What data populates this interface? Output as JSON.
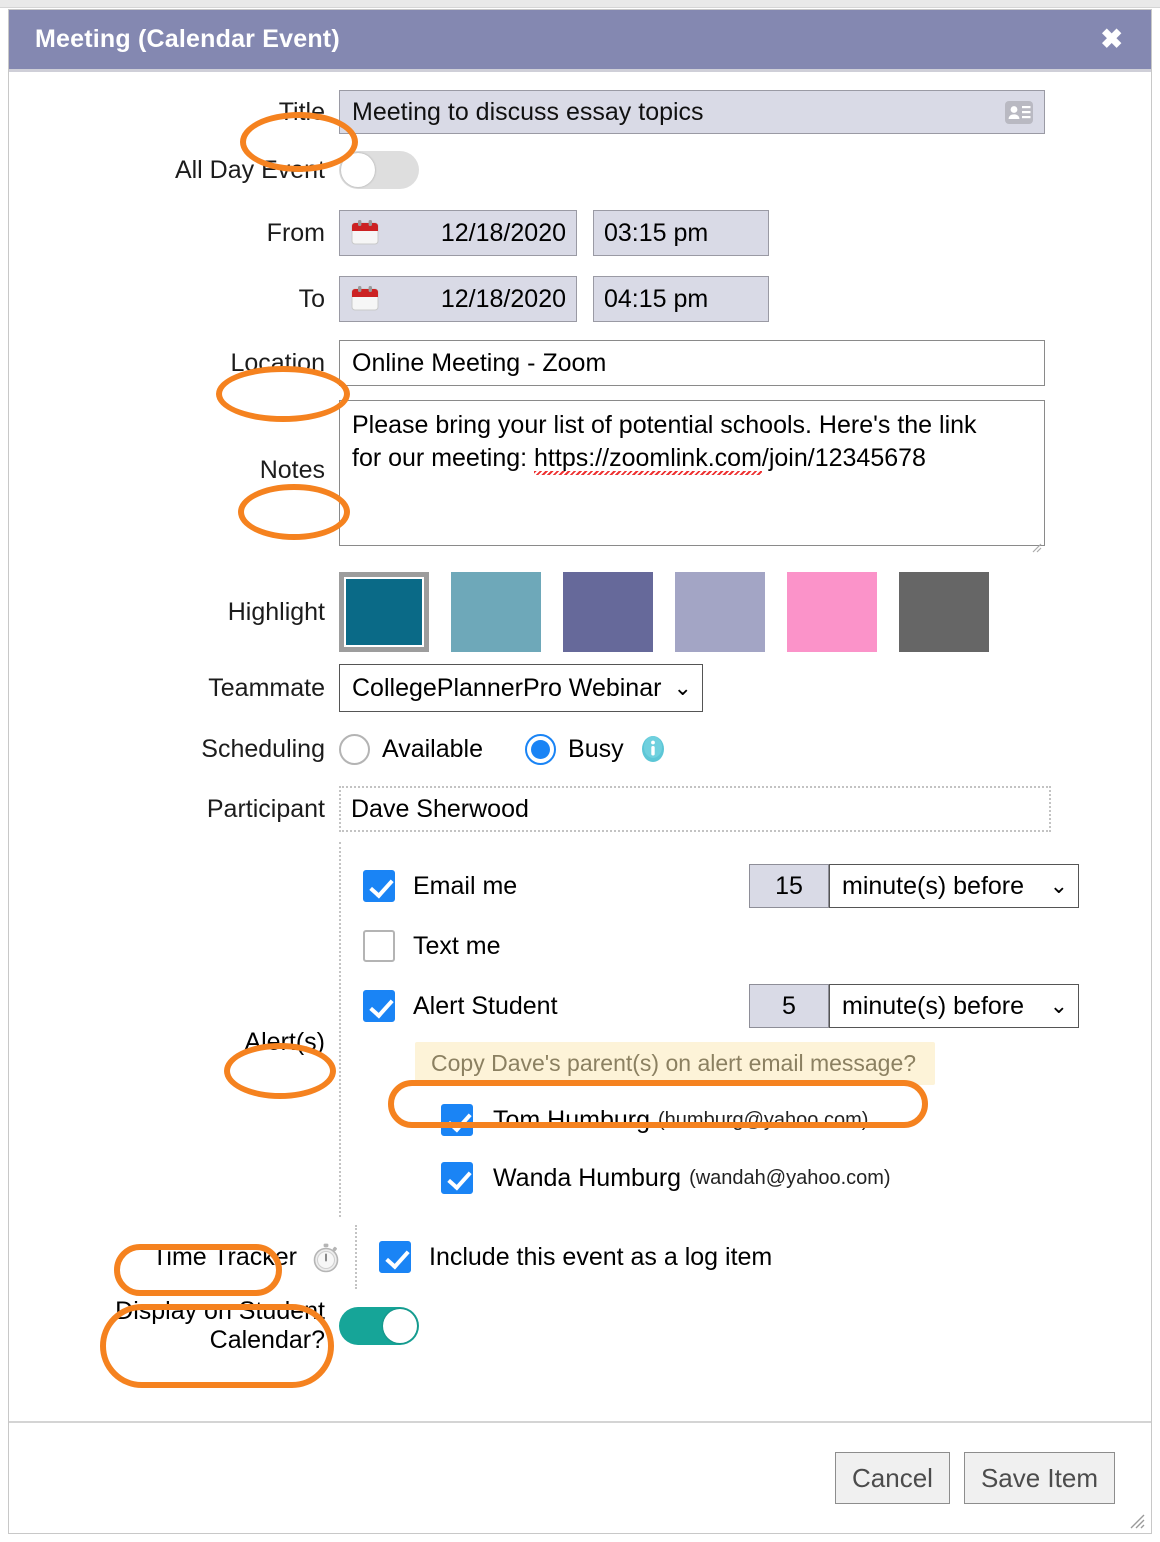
{
  "window": {
    "title": "Meeting (Calendar Event)",
    "close_label": "✖",
    "header_color": "#8488b1"
  },
  "form": {
    "title": {
      "label": "Title",
      "value": "Meeting to discuss essay topics",
      "icon": "contact-card-icon"
    },
    "all_day": {
      "label": "All Day Event",
      "state": "off"
    },
    "from": {
      "label": "From",
      "date": "12/18/2020",
      "time": "03:15 pm"
    },
    "to": {
      "label": "To",
      "date": "12/18/2020",
      "time": "04:15 pm"
    },
    "location": {
      "label": "Location",
      "value": "Online Meeting - Zoom"
    },
    "notes": {
      "label": "Notes",
      "line1": "Please bring your list of potential schools. Here's the link",
      "line2_prefix": "for our meeting: ",
      "line2_url": "https://zoomlink.com",
      "line2_suffix": "/join/12345678"
    },
    "highlight": {
      "label": "Highlight",
      "selected_index": 0,
      "colors": [
        "#0a6a87",
        "#6ea8b9",
        "#66699a",
        "#a3a5c5",
        "#fb93c9",
        "#666666"
      ]
    },
    "teammate": {
      "label": "Teammate",
      "value": "CollegePlannerPro Webinar",
      "caret": "⌄"
    },
    "scheduling": {
      "label": "Scheduling",
      "options": [
        {
          "label": "Available",
          "selected": false
        },
        {
          "label": "Busy",
          "selected": true
        }
      ],
      "info_icon": "info-icon"
    },
    "participant": {
      "label": "Participant",
      "value": "Dave Sherwood"
    },
    "alerts": {
      "label": "Alert(s)",
      "email_me": {
        "label": "Email me",
        "checked": true,
        "amount": "15",
        "unit": "minute(s) before",
        "caret": "⌄"
      },
      "text_me": {
        "label": "Text me",
        "checked": false
      },
      "alert_student": {
        "label": "Alert Student",
        "checked": true,
        "amount": "5",
        "unit": "minute(s) before",
        "caret": "⌄"
      },
      "copy_parents_banner": "Copy Dave's parent(s) on alert email message?",
      "parents": [
        {
          "name": "Tom Humburg",
          "email": "(humburg@yahoo.com)",
          "checked": true
        },
        {
          "name": "Wanda Humburg",
          "email": "(wandah@yahoo.com)",
          "checked": true
        }
      ]
    },
    "time_tracker": {
      "label": "Time Tracker",
      "icon": "stopwatch-icon",
      "checkbox_label": "Include this event as a log item",
      "checked": true
    },
    "display_student_calendar": {
      "label_line1": "Display on Student",
      "label_line2": "Calendar?",
      "state": "on"
    }
  },
  "footer": {
    "cancel_label": "Cancel",
    "save_label": "Save Item"
  },
  "annotations": {
    "accent_color": "#f5821f",
    "targets": [
      "Title",
      "Location",
      "Notes",
      "Alert(s)",
      "Copy parents banner",
      "Time Tracker",
      "Display on Student Calendar?"
    ]
  }
}
